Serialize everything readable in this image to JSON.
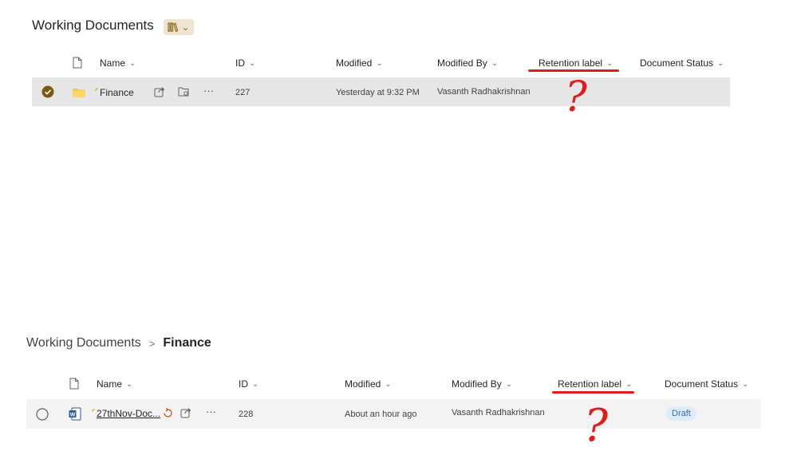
{
  "top": {
    "title": "Working Documents",
    "columns": {
      "name": "Name",
      "id": "ID",
      "modified": "Modified",
      "modified_by": "Modified By",
      "retention_label": "Retention label",
      "document_status": "Document Status"
    },
    "row": {
      "name": "Finance",
      "id": "227",
      "modified": "Yesterday at 9:32 PM",
      "modified_by": "Vasanth Radhakrishnan"
    },
    "annotation": "?"
  },
  "bottom": {
    "breadcrumb": [
      "Working Documents",
      "Finance"
    ],
    "breadcrumb_sep": ">",
    "columns": {
      "name": "Name",
      "id": "ID",
      "modified": "Modified",
      "modified_by": "Modified By",
      "retention_label": "Retention label",
      "document_status": "Document Status"
    },
    "row": {
      "name": "27thNov-Doc...",
      "id": "228",
      "modified": "About an hour ago",
      "modified_by": "Vasanth Radhakrishnan",
      "status": "Draft"
    },
    "annotation": "?"
  },
  "more_label": "···",
  "chevron": "⌄",
  "colors": {
    "annotation": "#e01b1b",
    "selected_check": "#7a5a12",
    "folder": "#f4c34a",
    "word": "#2b579a"
  }
}
